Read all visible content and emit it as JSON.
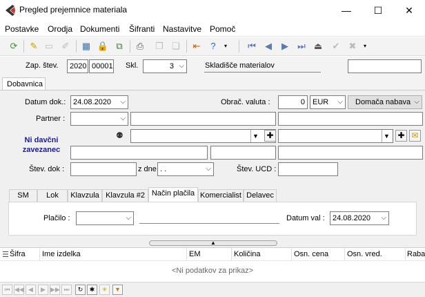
{
  "window": {
    "title": "Pregled prejemnice materiala",
    "minimize": "—",
    "maximize": "☐",
    "close": "✕"
  },
  "menu": [
    "Postavke",
    "Orodja",
    "Dokumenti",
    "Šifranti",
    "Nastavitve",
    "Pomoč"
  ],
  "toolbar_icons": [
    "refresh-icon",
    "new-icon",
    "open-folder-icon",
    "edit-icon",
    "calculator-icon",
    "lock-icon",
    "copy-icon",
    "print-icon",
    "copy-doc-icon",
    "paste-icon",
    "exit-icon",
    "help-icon",
    "first-icon",
    "prev-icon",
    "next-icon",
    "last-icon",
    "eject-icon",
    "confirm-icon",
    "cancel-icon"
  ],
  "header": {
    "zap_label": "Zap. štev.",
    "year": "2020",
    "number": "00001",
    "skl_label": "Skl.",
    "skl_value": "3",
    "warehouse_name": "Skladišče materialov",
    "extra_value": ""
  },
  "tab_top": "Dobavnica",
  "form": {
    "datum_label": "Datum dok.:",
    "datum_value": "24.08.2020",
    "obrac_label": "Obrač. valuta :",
    "valuta_amount": "0",
    "valuta": "EUR",
    "nabava": "Domača nabava",
    "partner_label": "Partner :",
    "partner_value": "",
    "tax_note": "Ni davčni zavezanec",
    "stev_dok_label": "Štev. dok :",
    "stev_dok_value": "",
    "z_dne_label": "z dne",
    "z_dne_value": " .  .",
    "stev_ucd_label": "Štev. UCD :",
    "stev_ucd_value": ""
  },
  "subtabs": [
    "SM",
    "Lok",
    "Klavzula",
    "Klavzula #2",
    "Način plačila",
    "Komercialist",
    "Delavec"
  ],
  "active_subtab": "Način plačila",
  "payment": {
    "placilo_label": "Plačilo :",
    "placilo_value": "",
    "datum_val_label": "Datum val :",
    "datum_val_value": "24.08.2020"
  },
  "grid": {
    "columns": [
      "Šifra",
      "Ime izdelka",
      "EM",
      "Količina",
      "Osn. cena",
      "Osn. vred.",
      "Raba"
    ],
    "empty_text": "<Ni podatkov za prikaz>"
  },
  "navbar_icons": [
    "first-icon",
    "prev-page-icon",
    "prev-icon",
    "next-icon",
    "next-page-icon",
    "last-icon",
    "refresh-icon",
    "asterisk-icon",
    "clear-icon",
    "filter-icon"
  ]
}
